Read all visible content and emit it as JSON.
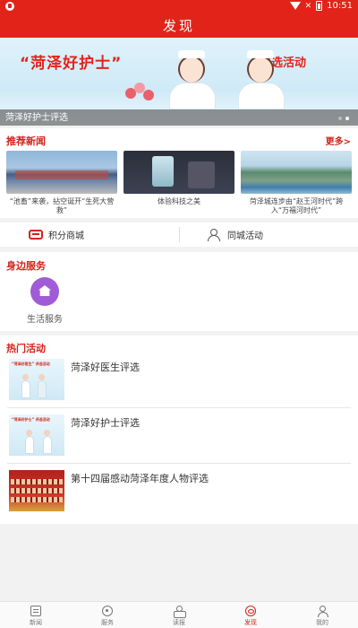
{
  "status_bar": {
    "time": "10:51",
    "signal_text": "✕"
  },
  "header": {
    "title": "发现"
  },
  "banner": {
    "title": "“菏泽好护士”",
    "subtitle": "评选活动",
    "caption": "菏泽好护士评选",
    "page_count": 2,
    "active_page": 2
  },
  "news": {
    "heading": "推荐新闻",
    "more_label": "更多>",
    "items": [
      {
        "caption": "“池畜”来袭，拈空诞开“生死大营救”"
      },
      {
        "caption": "体验科技之美"
      },
      {
        "caption": "菏泽城连步由“赵王河时代”跨入“万福河时代”"
      }
    ]
  },
  "quick_links": {
    "points_mall": "积分商城",
    "city_events": "同城活动"
  },
  "services": {
    "heading": "身边服务",
    "items": [
      {
        "label": "生活服务",
        "icon": "home-icon",
        "color": "#a05bd6"
      }
    ]
  },
  "hot_events": {
    "heading": "热门活动",
    "items": [
      {
        "title": "菏泽好医生评选",
        "thumb_text": "“菏泽好医生” 评选活动"
      },
      {
        "title": "菏泽好护士评选",
        "thumb_text": "“菏泽好护士” 评选活动"
      },
      {
        "title": "第十四届感动菏泽年度人物评选"
      }
    ]
  },
  "tabbar": {
    "tabs": [
      {
        "label": "新闻",
        "icon": "news-icon"
      },
      {
        "label": "服务",
        "icon": "service-icon"
      },
      {
        "label": "读报",
        "icon": "read-icon"
      },
      {
        "label": "发现",
        "icon": "discover-icon",
        "active": true
      },
      {
        "label": "我的",
        "icon": "mine-icon"
      }
    ]
  },
  "colors": {
    "brand": "#e2231a",
    "accent": "#d4231a",
    "service_icon": "#a05bd6"
  }
}
